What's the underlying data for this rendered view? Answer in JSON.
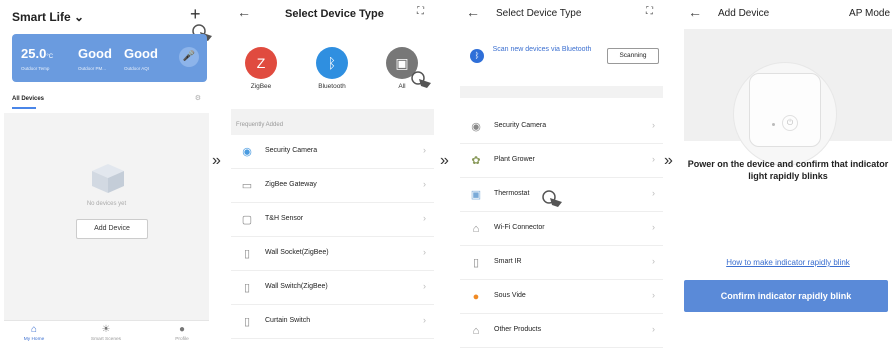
{
  "screen1": {
    "title": "Smart Life",
    "plus": "+",
    "weather": [
      {
        "value": "25.0",
        "unit": "°C",
        "label": "Outdoor Temp"
      },
      {
        "value": "Good",
        "label": "Outdoor PM..."
      },
      {
        "value": "Good",
        "label": "Outdoor AQI"
      }
    ],
    "tab": "All Devices",
    "empty_text": "No devices yet",
    "add_button": "Add Device",
    "nav": [
      "My Home",
      "Smart Scenes",
      "Profile"
    ]
  },
  "screen2": {
    "title": "Select Device Type",
    "types": [
      "ZigBee",
      "Bluetooth",
      "All"
    ],
    "section": "Frequently Added",
    "items": [
      "Security Camera",
      "ZigBee Gateway",
      "T&H Sensor",
      "Wall Socket(ZigBee)",
      "Wall Switch(ZigBee)",
      "Curtain Switch"
    ]
  },
  "screen3": {
    "title": "Select Device Type",
    "scan_text": "Scan new devices via Bluetooth",
    "scan_button": "Scanning",
    "items": [
      "Security Camera",
      "Plant Grower",
      "Thermostat",
      "Wi-Fi Connector",
      "Smart IR",
      "Sous Vide",
      "Other Products"
    ]
  },
  "screen4": {
    "title": "Add Device",
    "mode": "AP Mode",
    "message": "Power on the device and confirm that indicator light rapidly blinks",
    "link": "How to make indicator rapidly blink",
    "button": "Confirm indicator rapidly blink"
  },
  "separator": "»",
  "colors": {
    "accent": "#5a8ad8",
    "link": "#3b6fd0",
    "card": "#6a9bdf"
  }
}
